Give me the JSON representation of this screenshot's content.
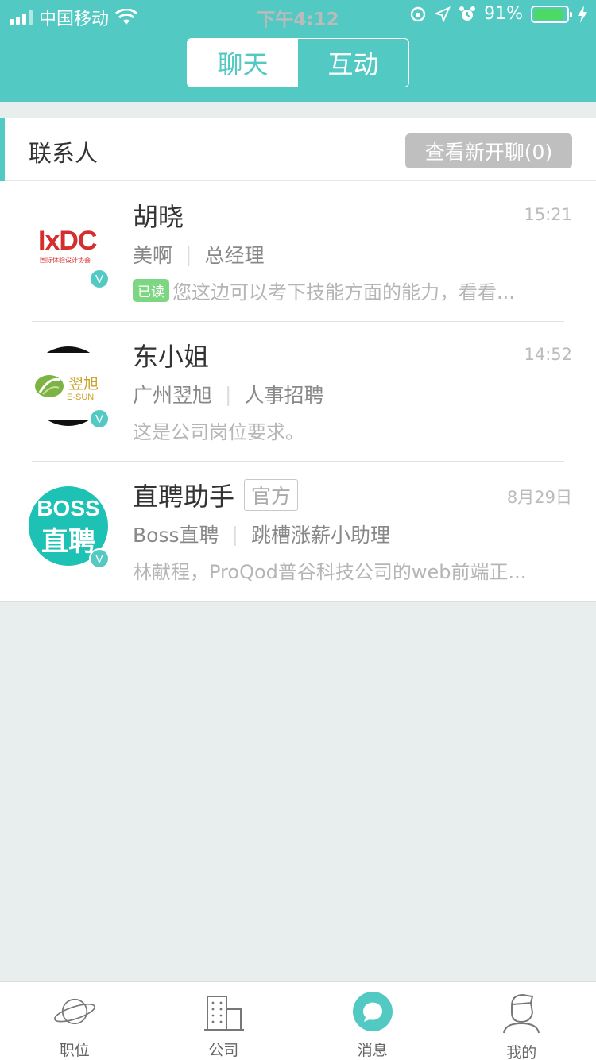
{
  "status_bar": {
    "carrier": "中国移动",
    "time": "下午4:12",
    "battery": "91%"
  },
  "segment": {
    "tabs": [
      {
        "label": "聊天",
        "active": true
      },
      {
        "label": "互动",
        "active": false
      }
    ]
  },
  "contacts_header": {
    "title": "联系人",
    "new_chat_button": "查看新开聊(0)"
  },
  "conversations": [
    {
      "name": "胡晓",
      "time": "15:21",
      "company": "美啊",
      "position": "总经理",
      "read_tag": "已读",
      "message": "您这边可以考下技能方面的能力，看看...",
      "avatar_text": "IxDC",
      "avatar_subtext": "国际体验设计协会",
      "badge": "V"
    },
    {
      "name": "东小姐",
      "time": "14:52",
      "company": "广州翌旭",
      "position": "人事招聘",
      "message": "这是公司岗位要求。",
      "avatar_text": "翌旭",
      "avatar_subtext": "E-SUN",
      "badge": "V"
    },
    {
      "name": "直聘助手",
      "official_tag": "官方",
      "time": "8月29日",
      "company": "Boss直聘",
      "position": "跳槽涨薪小助理",
      "message": "林献程，ProQod普谷科技公司的web前端正...",
      "avatar_text": "BOSS",
      "avatar_subtext": "直聘",
      "badge": "V"
    }
  ],
  "tabbar": {
    "items": [
      {
        "label": "职位",
        "icon": "planet-icon"
      },
      {
        "label": "公司",
        "icon": "building-icon"
      },
      {
        "label": "消息",
        "icon": "chat-bubble-icon",
        "active": true
      },
      {
        "label": "我的",
        "icon": "user-icon"
      }
    ]
  },
  "colors": {
    "brand": "#53c9c3",
    "read_tag": "#7dd682"
  }
}
